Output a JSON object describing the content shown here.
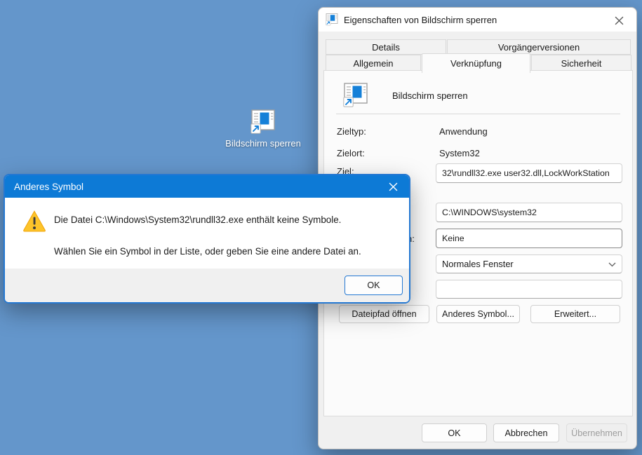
{
  "desktop": {
    "background_color": "#6496cb",
    "shortcut_label": "Bildschirm sperren"
  },
  "properties_dialog": {
    "title": "Eigenschaften von Bildschirm sperren",
    "tabs": {
      "row1": [
        {
          "label": "Details"
        },
        {
          "label": "Vorgängerversionen"
        }
      ],
      "row2": [
        {
          "label": "Allgemein"
        },
        {
          "label": "Verknüpfung",
          "active": true
        },
        {
          "label": "Sicherheit"
        }
      ]
    },
    "shortcut_name": "Bildschirm sperren",
    "fields": {
      "zieltyp": {
        "label": "Zieltyp:",
        "value": "Anwendung"
      },
      "zielort": {
        "label": "Zielort:",
        "value": "System32"
      },
      "ziel": {
        "label": "Ziel:",
        "value": "32\\rundll32.exe user32.dll,LockWorkStation"
      },
      "ausfuehren_in": {
        "value": "C:\\WINDOWS\\system32"
      },
      "tastenkombination": {
        "label_fragment": "n:",
        "value": "Keine"
      },
      "ausfuehren": {
        "value": "Normales Fenster"
      },
      "kommentar": {
        "value": ""
      }
    },
    "action_buttons": {
      "dateipfad_oeffnen": "Dateipfad öffnen",
      "anderes_symbol": "Anderes Symbol...",
      "erweitert": "Erweitert..."
    },
    "footer_buttons": {
      "ok": "OK",
      "abbrechen": "Abbrechen",
      "uebernehmen": "Übernehmen"
    }
  },
  "icon_dialog": {
    "title": "Anderes Symbol",
    "message_line1": "Die Datei C:\\Windows\\System32\\rundll32.exe enthält keine Symbole.",
    "message_line2": "Wählen Sie ein Symbol in der Liste, oder geben Sie eine andere Datei an.",
    "ok": "OK"
  },
  "colors": {
    "desktop_bg": "#6496cb",
    "accent_blue": "#0d7ad6",
    "dialog_bg": "#f0f0f0",
    "panel_bg": "#fbfbfb",
    "warning_yellow": "#fdc42a"
  }
}
